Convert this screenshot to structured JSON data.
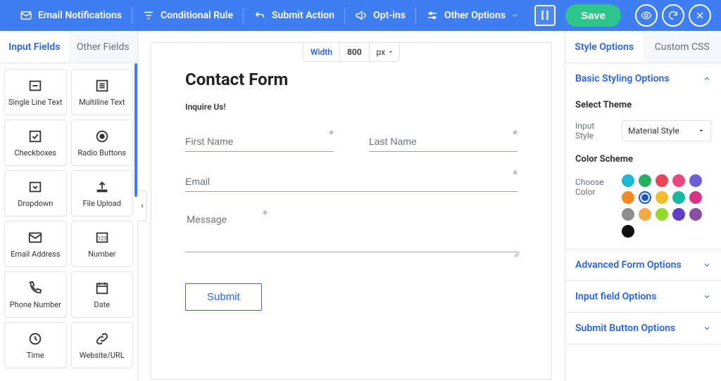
{
  "topbar": {
    "items": [
      {
        "label": "Email Notifications"
      },
      {
        "label": "Conditional Rule"
      },
      {
        "label": "Submit Action"
      },
      {
        "label": "Opt-ins"
      },
      {
        "label": "Other Options"
      }
    ],
    "save_label": "Save"
  },
  "left": {
    "tabs": [
      "Input Fields",
      "Other Fields"
    ],
    "active_tab": 0,
    "tiles": [
      {
        "label": "Single Line Text"
      },
      {
        "label": "Multiline Text"
      },
      {
        "label": "Checkboxes"
      },
      {
        "label": "Radio Buttons"
      },
      {
        "label": "Dropdown"
      },
      {
        "label": "File Upload"
      },
      {
        "label": "Email Address"
      },
      {
        "label": "Number"
      },
      {
        "label": "Phone Number"
      },
      {
        "label": "Date"
      },
      {
        "label": "Time"
      },
      {
        "label": "Website/URL"
      }
    ]
  },
  "canvas": {
    "width_label": "Width",
    "width_value": "800",
    "width_unit": "px",
    "form_title": "Contact Form",
    "form_sub": "Inquire Us!",
    "fields": {
      "first_name": "First Name",
      "last_name": "Last Name",
      "email": "Email",
      "message": "Message"
    },
    "submit_label": "Submit"
  },
  "right": {
    "tabs": [
      "Style Options",
      "Custom CSS"
    ],
    "active_tab": 0,
    "sections": {
      "basic": "Basic Styling Options",
      "advanced": "Advanced Form Options",
      "input": "Input field Options",
      "submit": "Submit Button Options"
    },
    "select_theme_title": "Select Theme",
    "input_style_label": "Input Style",
    "input_style_value": "Material Style",
    "color_scheme_title": "Color Scheme",
    "choose_color_label": "Choose Color",
    "colors": [
      "#1cb8d6",
      "#27ae60",
      "#e8475b",
      "#e8477f",
      "#6b5ed6",
      "#f58a1f",
      "#1858c9",
      "#f2bd2c",
      "#18b5a0",
      "#d63384",
      "#8e8e8e",
      "#f0a94a",
      "#94d82d",
      "#5f3dc4",
      "#8a4fa0",
      "#111111"
    ],
    "selected_color_index": 6
  }
}
